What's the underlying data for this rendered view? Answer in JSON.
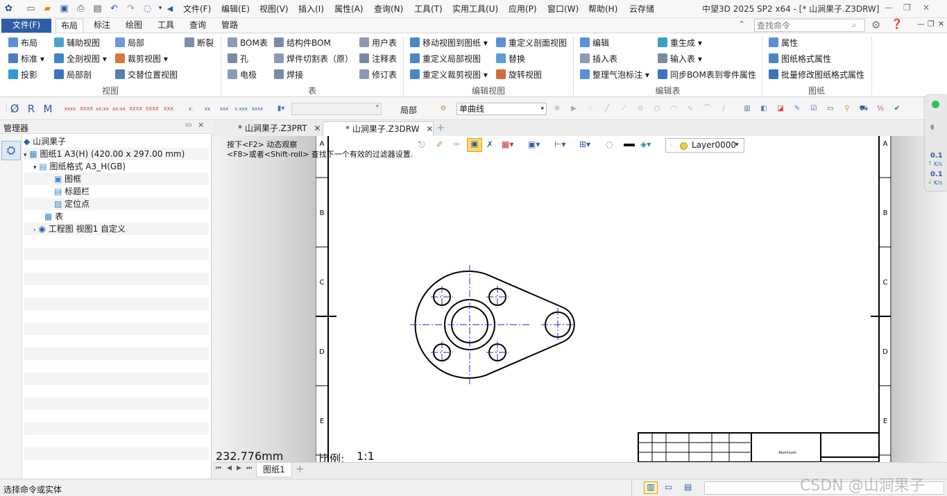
{
  "app": {
    "window_title": "中望3D 2025 SP2 x64 - [* 山涧果子.Z3DRW]",
    "menus": [
      "文件(F)",
      "编辑(E)",
      "视图(V)",
      "插入(I)",
      "属性(A)",
      "查询(N)",
      "工具(T)",
      "实用工具(U)",
      "应用(P)",
      "窗口(W)",
      "帮助(H)",
      "云存储"
    ]
  },
  "ribbon_tabs": [
    "文件(F)",
    "布局",
    "标注",
    "绘图",
    "工具",
    "查询",
    "管路"
  ],
  "active_tab": "布局",
  "search": {
    "placeholder": "查找命令"
  },
  "ribbon_groups": [
    {
      "label": "视图",
      "buttons": [
        "布局",
        "辅助视图",
        "局部",
        "断裂",
        "标准",
        "全剖视图",
        "裁剪视图",
        "投影",
        "局部剖",
        "交替位置视图"
      ]
    },
    {
      "label": "表",
      "buttons": [
        "BOM表",
        "结构件BOM",
        "用户表",
        "孔",
        "焊件切割表（原）",
        "注释表",
        "电极",
        "焊接",
        "修订表"
      ]
    },
    {
      "label": "编辑视图",
      "buttons": [
        "移动视图到图纸",
        "重定义剖面视图",
        "重定义局部视图",
        "替换",
        "重定义裁剪视图",
        "旋转视图"
      ]
    },
    {
      "label": "编辑表",
      "buttons": [
        "编辑",
        "重生成",
        "插入表",
        "输入表",
        "整理气泡标注",
        "同步BOM表到零件属性"
      ]
    },
    {
      "label": "图纸",
      "buttons": [
        "属性",
        "图纸格式属性",
        "批量修改图纸格式属性"
      ]
    }
  ],
  "toolbar": {
    "scope_label": "局部",
    "line_type": "单曲线",
    "layer": "Layer0000"
  },
  "manager": {
    "title": "管理器",
    "tree": [
      {
        "label": "山涧果子",
        "level": 0,
        "icon": "part-icon"
      },
      {
        "label": "图纸1 A3(H) (420.00 x 297.00 mm)",
        "level": 1,
        "icon": "sheet-icon",
        "expanded": true
      },
      {
        "label": "图纸格式 A3_H(GB)",
        "level": 2,
        "icon": "format-icon",
        "expanded": true
      },
      {
        "label": "图框",
        "level": 3,
        "icon": "frame-icon"
      },
      {
        "label": "标题栏",
        "level": 3,
        "icon": "titleblock-icon"
      },
      {
        "label": "定位点",
        "level": 3,
        "icon": "anchor-icon"
      },
      {
        "label": "表",
        "level": 2,
        "icon": "table-icon"
      },
      {
        "label": "工程图 视图1 自定义",
        "level": 2,
        "icon": "view-icon",
        "expanded": false
      }
    ]
  },
  "doc_tabs": [
    {
      "label": "* 山涧果子.Z3PRT",
      "active": false
    },
    {
      "label": "* 山涧果子.Z3DRW",
      "active": true
    }
  ],
  "canvas": {
    "hint1": "按下<F2> 动态观察",
    "hint2": "<F8>或者<Shift-roll> 查找下一个有效的过滤器设置.",
    "measure": "232.776mm",
    "scale_label": "比例:",
    "scale_value": "1:1",
    "border_letters": [
      "A",
      "B",
      "C",
      "D",
      "E"
    ],
    "titleblock_text": "Aluminum"
  },
  "sheet_tabs": [
    "图纸1"
  ],
  "status": {
    "prompt": "选择命令或实体",
    "watermark": "CSDN @山涧果子"
  },
  "meter": {
    "up": "0.1",
    "up_unit": "K/s",
    "down": "0.1",
    "down_unit": "K/s"
  },
  "colors": {
    "accent": "#2c5da6",
    "centerline": "#2323c8",
    "geometry": "#000000"
  }
}
